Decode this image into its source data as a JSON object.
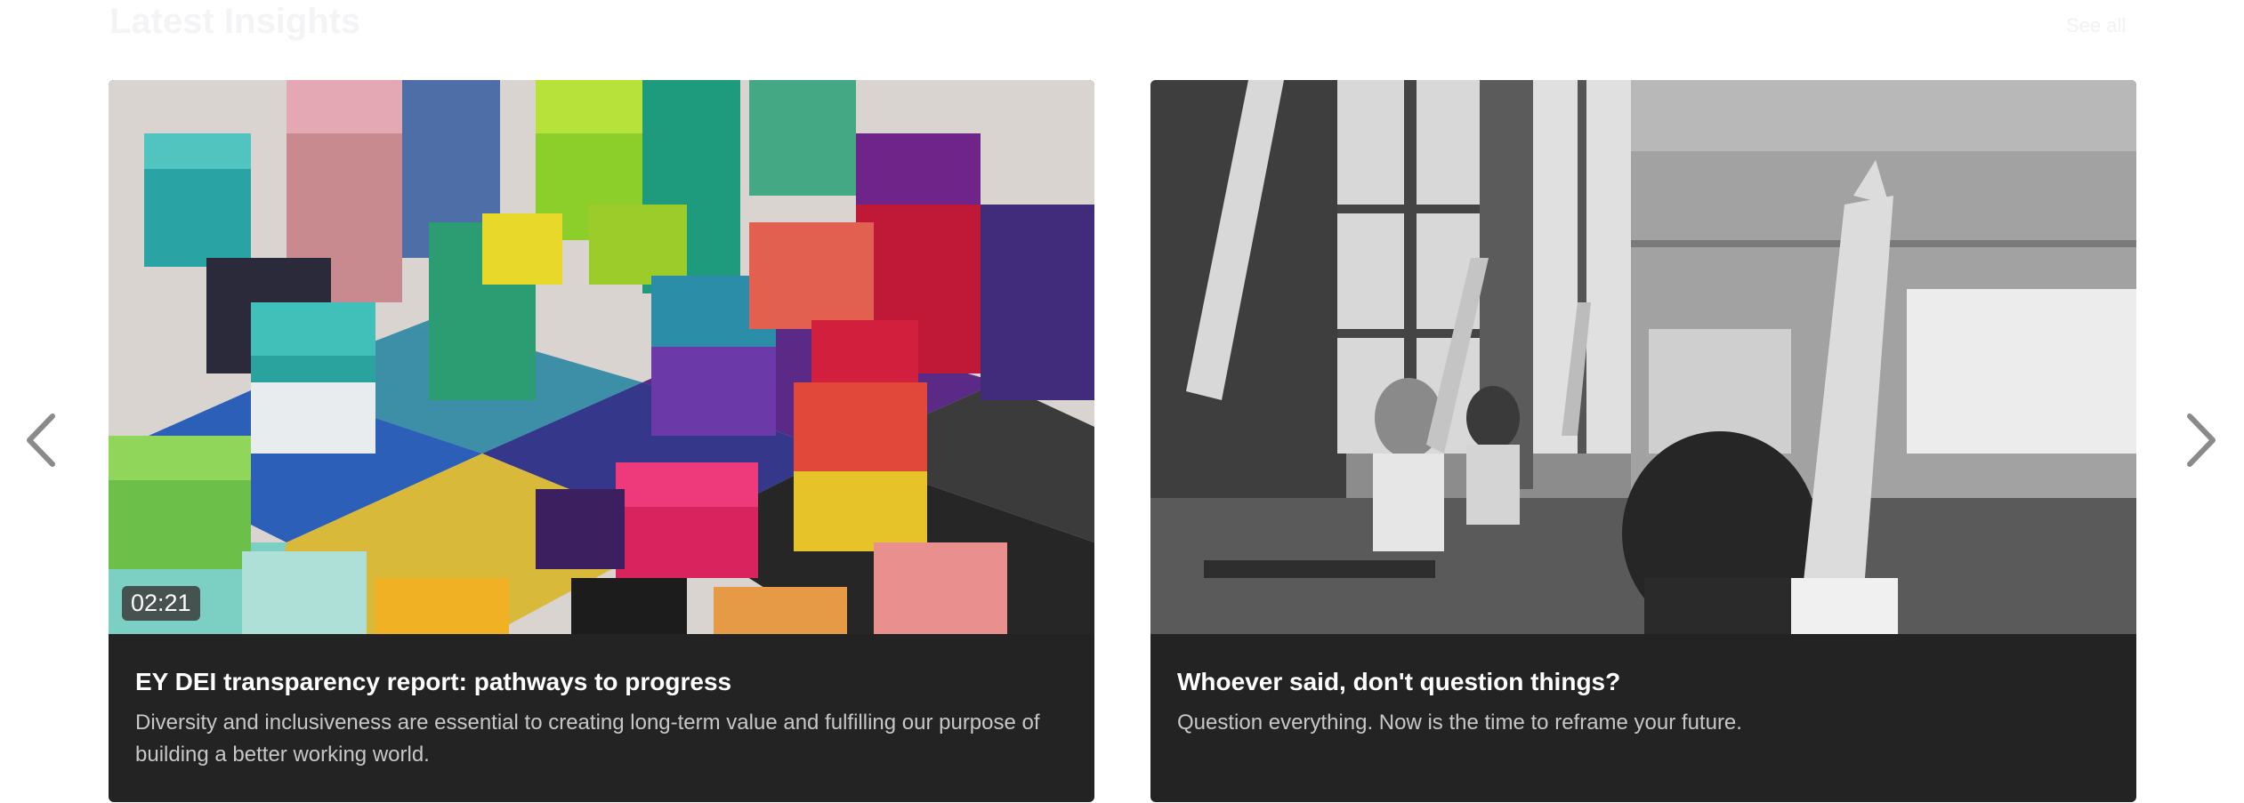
{
  "section": {
    "title": "Latest Insights",
    "see_all": "See all"
  },
  "carousel": {
    "prev_icon": "chevron-left-icon",
    "next_icon": "chevron-right-icon",
    "chevron_color": "#8a8a8a"
  },
  "cards": [
    {
      "title": "EY DEI transparency report: pathways to progress",
      "description": "Diversity and inclusiveness are essential to creating long-term value and fulfilling our purpose of building a better working world.",
      "duration": "02:21",
      "image": "colorful-wooden-blocks"
    },
    {
      "title": "Whoever said, don't question things?",
      "description": "Question everything. Now is the time to reframe your future.",
      "image": "classroom-raised-hands"
    }
  ],
  "colors": {
    "card_background": "#232323",
    "title_text": "#ffffff",
    "description_text": "#c7c7c7"
  }
}
